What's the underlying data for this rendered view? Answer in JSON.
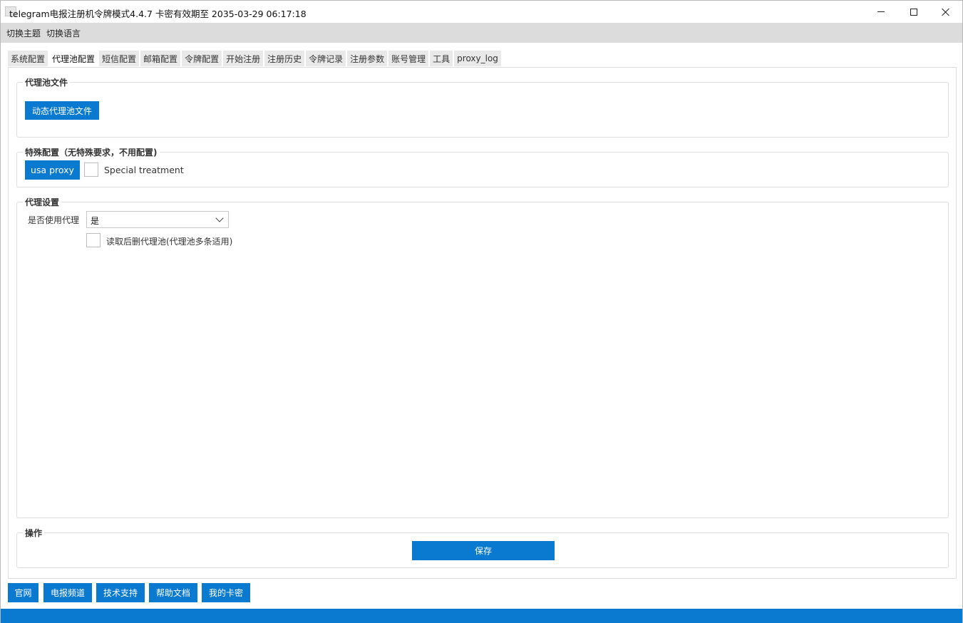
{
  "window": {
    "title": "telegram电报注册机令牌模式4.4.7 卡密有效期至 2035-03-29 06:17:18",
    "minimize_icon": "minimize-icon",
    "maximize_icon": "maximize-icon",
    "close_icon": "close-icon"
  },
  "menubar": {
    "items": [
      "切换主题",
      "切换语言"
    ]
  },
  "tabs": {
    "items": [
      "系统配置",
      "代理池配置",
      "短信配置",
      "邮箱配置",
      "令牌配置",
      "开始注册",
      "注册历史",
      "令牌记录",
      "注册参数",
      "账号管理",
      "工具",
      "proxy_log"
    ],
    "active": "代理池配置"
  },
  "proxy_file_group": {
    "title": "代理池文件",
    "dynamic_button": "动态代理池文件"
  },
  "special_group": {
    "title": "特殊配置（无特殊要求，不用配置)",
    "usa_button": "usa proxy",
    "special_checkbox_label": "Special treatment",
    "special_checked": false
  },
  "proxy_settings_group": {
    "title": "代理设置",
    "use_proxy_label": "是否使用代理",
    "use_proxy_value": "是",
    "delete_after_read_label": "读取后删代理池(代理池多条适用)",
    "delete_after_read_checked": false
  },
  "operation_group": {
    "title": "操作",
    "save_button": "保存"
  },
  "footer": {
    "buttons": [
      "官网",
      "电报频道",
      "技术支持",
      "帮助文档",
      "我的卡密"
    ]
  },
  "colors": {
    "accent": "#0a79d0",
    "menubar": "#dcdcdc",
    "tab_inactive": "#e9e9e9"
  }
}
